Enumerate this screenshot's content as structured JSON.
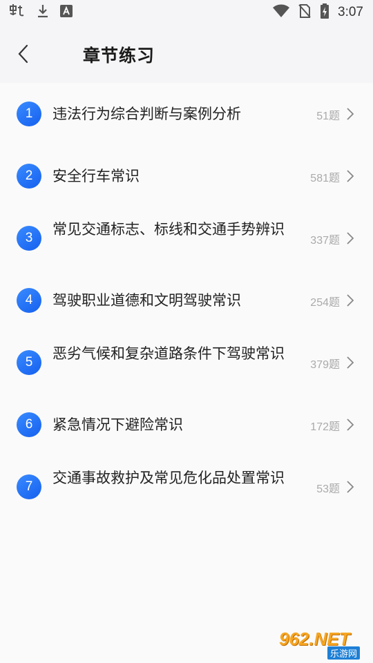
{
  "status_bar": {
    "time": "3:07",
    "icons": [
      "app-icon",
      "download-icon",
      "a-icon",
      "wifi-icon",
      "no-sim-icon",
      "battery-charging-icon"
    ]
  },
  "header": {
    "title": "章节练习",
    "back_icon": "chevron-left-icon"
  },
  "chapters": [
    {
      "index": "1",
      "title": "违法行为综合判断与案例分析",
      "count": "51题"
    },
    {
      "index": "2",
      "title": "安全行车常识",
      "count": "581题"
    },
    {
      "index": "3",
      "title": "常见交通标志、标线和交通手势辨识",
      "count": "337题"
    },
    {
      "index": "4",
      "title": "驾驶职业道德和文明驾驶常识",
      "count": "254题"
    },
    {
      "index": "5",
      "title": "恶劣气候和复杂道路条件下驾驶常识",
      "count": "379题"
    },
    {
      "index": "6",
      "title": "紧急情况下避险常识",
      "count": "172题"
    },
    {
      "index": "7",
      "title": "交通事故救护及常见危化品处置常识",
      "count": "53题"
    }
  ],
  "watermark": {
    "main": "962.NET",
    "sub": "乐游网"
  },
  "colors": {
    "accent": "#2a78f5",
    "background": "#f5f5f7",
    "count_text": "#aaaaaa"
  }
}
